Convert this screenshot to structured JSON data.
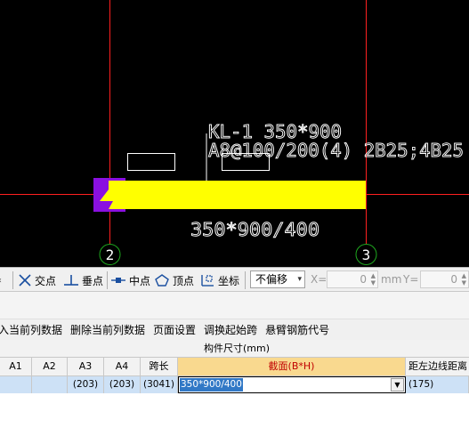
{
  "canvas": {
    "beam_label": "KL-1 350*900",
    "reinforcement_label": "A8@100/200(4) 2B25;4B25",
    "section_label": "350*900/400",
    "axis_left": "2",
    "axis_right": "3",
    "colors": {
      "beam": "#ffff00",
      "support": "#8a10e0",
      "axis": "#ff2020",
      "axis_bubble": "#1fa81f"
    }
  },
  "snap_toolbar": {
    "intersection": "交点",
    "perpendicular": "垂点",
    "midpoint": "中点",
    "vertex": "顶点",
    "coordinate": "坐标",
    "offset_mode": "不偏移",
    "x_label": "X=",
    "x_value": "0",
    "unit": "mm",
    "y_label": "Y=",
    "y_value": "0"
  },
  "menu": {
    "items": [
      "入当前列数据",
      "删除当前列数据",
      "页面设置",
      "调换起始跨",
      "悬臂钢筋代号"
    ]
  },
  "grid": {
    "group_header": "构件尺寸(mm)",
    "columns": [
      "A1",
      "A2",
      "A3",
      "A4",
      "跨长",
      "截面(B*H)",
      "距左边线距离"
    ],
    "row": [
      "",
      "",
      "(203)",
      "(203)",
      "(3041)",
      "350*900/400",
      "(175)"
    ]
  }
}
